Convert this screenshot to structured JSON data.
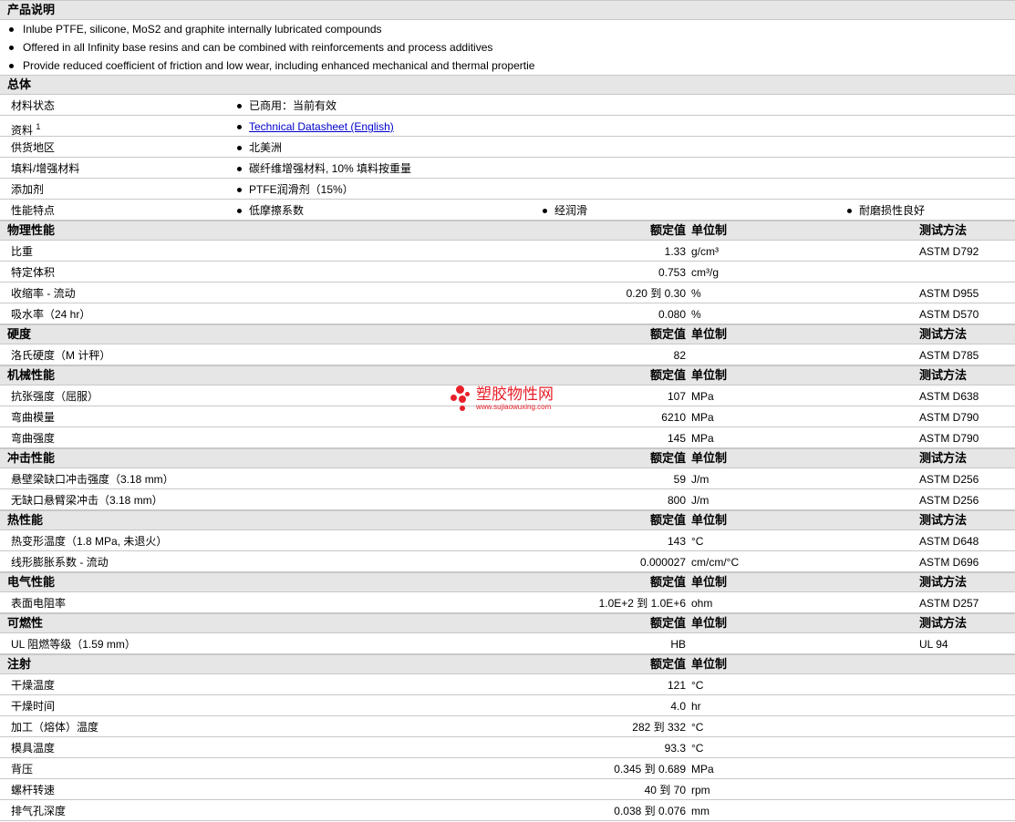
{
  "description": {
    "title": "产品说明",
    "bullets": [
      "Inlube PTFE, silicone, MoS2 and graphite internally lubricated compounds",
      "Offered in all Infinity base resins and can be combined with reinforcements and process additives",
      "Provide reduced coefficient of friction and low wear, including enhanced mechanical and thermal propertie"
    ]
  },
  "general": {
    "title": "总体",
    "rows": [
      {
        "label": "材料状态",
        "values": [
          "已商用：当前有效"
        ]
      },
      {
        "label": "资料",
        "sup": "1",
        "link": "Technical Datasheet (English)"
      },
      {
        "label": "供货地区",
        "values": [
          "北美洲"
        ]
      },
      {
        "label": "填料/增强材料",
        "values": [
          "碳纤维增强材料, 10% 填料按重量"
        ]
      },
      {
        "label": "添加剂",
        "values": [
          "PTFE润滑剂（15%）"
        ]
      },
      {
        "label": "性能特点",
        "values": [
          "低摩擦系数",
          "经润滑",
          "耐磨损性良好"
        ]
      }
    ]
  },
  "headers": {
    "value": "额定值",
    "unit": "单位制",
    "method": "测试方法"
  },
  "sections": [
    {
      "title": "物理性能",
      "show_headers": true,
      "rows": [
        [
          "比重",
          "1.33",
          "g/cm³",
          "ASTM D792"
        ],
        [
          "特定体积",
          "0.753",
          "cm³/g",
          ""
        ],
        [
          "收缩率 - 流动",
          "0.20 到 0.30",
          "%",
          "ASTM D955"
        ],
        [
          "吸水率（24 hr）",
          "0.080",
          "%",
          "ASTM D570"
        ]
      ]
    },
    {
      "title": "硬度",
      "show_headers": true,
      "rows": [
        [
          "洛氏硬度（M 计秤）",
          "82",
          "",
          "ASTM D785"
        ]
      ]
    },
    {
      "title": "机械性能",
      "show_headers": true,
      "rows": [
        [
          "抗张强度（屈服）",
          "107",
          "MPa",
          "ASTM D638"
        ],
        [
          "弯曲模量",
          "6210",
          "MPa",
          "ASTM D790"
        ],
        [
          "弯曲强度",
          "145",
          "MPa",
          "ASTM D790"
        ]
      ]
    },
    {
      "title": "冲击性能",
      "show_headers": true,
      "rows": [
        [
          "悬壁梁缺口冲击强度（3.18 mm）",
          "59",
          "J/m",
          "ASTM D256"
        ],
        [
          "无缺口悬臂梁冲击（3.18 mm）",
          "800",
          "J/m",
          "ASTM D256"
        ]
      ]
    },
    {
      "title": "热性能",
      "show_headers": true,
      "rows": [
        [
          "热变形温度（1.8 MPa, 未退火）",
          "143",
          "°C",
          "ASTM D648"
        ],
        [
          "线形膨胀系数 - 流动",
          "0.000027",
          "cm/cm/°C",
          "ASTM D696"
        ]
      ]
    },
    {
      "title": "电气性能",
      "show_headers": true,
      "rows": [
        [
          "表面电阻率",
          "1.0E+2 到 1.0E+6",
          "ohm",
          "ASTM D257"
        ]
      ]
    },
    {
      "title": "可燃性",
      "show_headers": true,
      "rows": [
        [
          "UL 阻燃等级（1.59 mm）",
          "HB",
          "",
          "UL 94"
        ]
      ]
    },
    {
      "title": "注射",
      "show_headers": "partial",
      "rows": [
        [
          "干燥温度",
          "121",
          "°C",
          ""
        ],
        [
          "干燥时间",
          "4.0",
          "hr",
          ""
        ],
        [
          "加工（熔体）温度",
          "282 到 332",
          "°C",
          ""
        ],
        [
          "模具温度",
          "93.3",
          "°C",
          ""
        ],
        [
          "背压",
          "0.345 到 0.689",
          "MPa",
          ""
        ],
        [
          "螺杆转速",
          "40 到 70",
          "rpm",
          ""
        ],
        [
          "排气孔深度",
          "0.038 到 0.076",
          "mm",
          ""
        ]
      ]
    }
  ],
  "watermark": {
    "name": "塑胶物性网",
    "url": "www.sujiaowuxing.com"
  }
}
